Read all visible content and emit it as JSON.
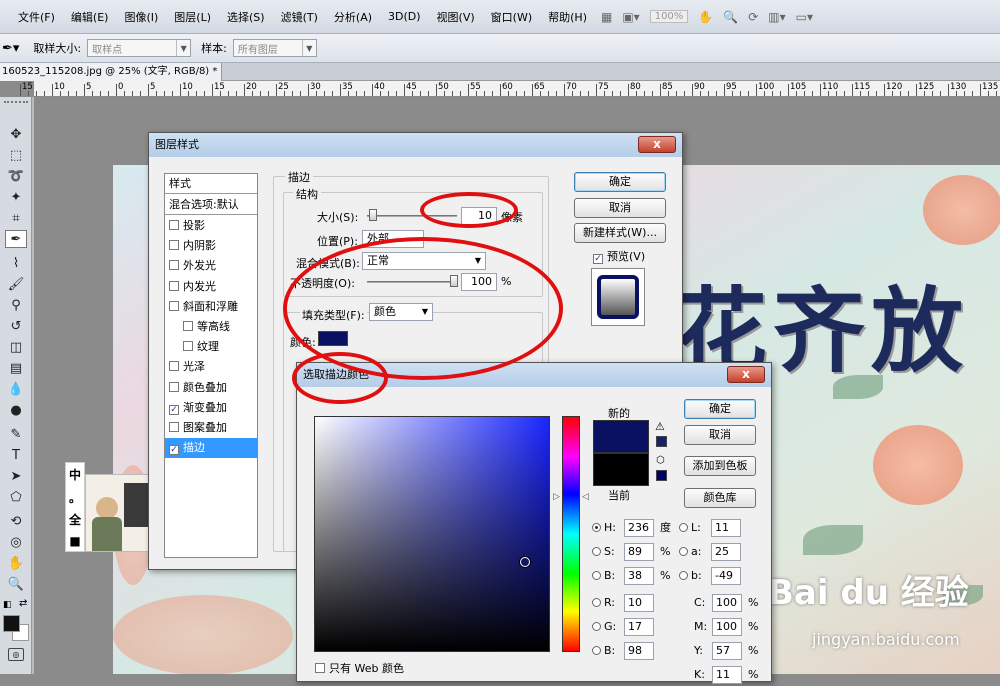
{
  "menu": [
    "文件(F)",
    "编辑(E)",
    "图像(I)",
    "图层(L)",
    "选择(S)",
    "滤镜(T)",
    "分析(A)",
    "3D(D)",
    "视图(V)",
    "窗口(W)",
    "帮助(H)"
  ],
  "menu_zoom": "100%",
  "options": {
    "sample_size_label": "取样大小:",
    "sample_size_value": "取样点",
    "sample_label": "样本:",
    "sample_value": "所有图层"
  },
  "doc_tab": "160523_115208.jpg @ 25% (文字, RGB/8) *",
  "ruler": [
    "15",
    "10",
    "5",
    "0",
    "5",
    "10",
    "15",
    "20",
    "25",
    "30",
    "35",
    "40",
    "45",
    "50",
    "55",
    "60",
    "65",
    "70",
    "75",
    "80",
    "85",
    "90",
    "95",
    "100",
    "105",
    "110",
    "115",
    "120",
    "125",
    "130",
    "135"
  ],
  "canvas": {
    "title_text": "花齐放",
    "watermark": "Bai du 经验",
    "watermark_sub": "jingyan.baidu.com",
    "sticker_chars": [
      "中",
      "。",
      "全",
      "■"
    ]
  },
  "layer_style": {
    "title": "图层样式",
    "close": "x",
    "styles_header": "样式",
    "blend_header": "混合选项:默认",
    "effects": [
      {
        "label": "投影",
        "checked": false,
        "indent": false
      },
      {
        "label": "内阴影",
        "checked": false,
        "indent": false
      },
      {
        "label": "外发光",
        "checked": false,
        "indent": false
      },
      {
        "label": "内发光",
        "checked": false,
        "indent": false
      },
      {
        "label": "斜面和浮雕",
        "checked": false,
        "indent": false
      },
      {
        "label": "等高线",
        "checked": false,
        "indent": true
      },
      {
        "label": "纹理",
        "checked": false,
        "indent": true
      },
      {
        "label": "光泽",
        "checked": false,
        "indent": false
      },
      {
        "label": "颜色叠加",
        "checked": false,
        "indent": false
      },
      {
        "label": "渐变叠加",
        "checked": true,
        "indent": false
      },
      {
        "label": "图案叠加",
        "checked": false,
        "indent": false
      },
      {
        "label": "描边",
        "checked": true,
        "indent": false,
        "selected": true
      }
    ],
    "stroke_group": "描边",
    "structure_group": "结构",
    "size_label": "大小(S):",
    "size_value": "10",
    "size_unit": "像素",
    "position_label": "位置(P):",
    "position_value": "外部",
    "blend_mode_label": "混合模式(B):",
    "blend_mode_value": "正常",
    "opacity_label": "不透明度(O):",
    "opacity_value": "100",
    "opacity_unit": "%",
    "fill_type_label": "填充类型(F):",
    "fill_type_value": "颜色",
    "color_label": "颜色:",
    "stroke_color": "#0b1162",
    "ok": "确定",
    "cancel": "取消",
    "new_style": "新建样式(W)...",
    "preview_label": "预览(V)"
  },
  "color_picker": {
    "title": "选取描边颜色",
    "close": "x",
    "new_label": "新的",
    "current_label": "当前",
    "new_color": "#0a1162",
    "current_color": "#000000",
    "ok": "确定",
    "cancel": "取消",
    "add_swatch": "添加到色板",
    "color_library": "颜色库",
    "hsb": [
      {
        "label": "H:",
        "value": "236",
        "unit": "度",
        "on": true
      },
      {
        "label": "S:",
        "value": "89",
        "unit": "%",
        "on": false
      },
      {
        "label": "B:",
        "value": "38",
        "unit": "%",
        "on": false
      }
    ],
    "lab": [
      {
        "label": "L:",
        "value": "11"
      },
      {
        "label": "a:",
        "value": "25"
      },
      {
        "label": "b:",
        "value": "-49"
      }
    ],
    "rgb": [
      {
        "label": "R:",
        "value": "10"
      },
      {
        "label": "G:",
        "value": "17"
      },
      {
        "label": "B:",
        "value": "98"
      }
    ],
    "cmyk": [
      {
        "label": "C:",
        "value": "100",
        "unit": "%"
      },
      {
        "label": "M:",
        "value": "100",
        "unit": "%"
      },
      {
        "label": "Y:",
        "value": "57",
        "unit": "%"
      },
      {
        "label": "K:",
        "value": "11",
        "unit": "%"
      }
    ],
    "web_only_label": "只有 Web 颜色"
  },
  "colors": {
    "annotation_red": "#e01010",
    "selection_blue": "#3399ff"
  }
}
